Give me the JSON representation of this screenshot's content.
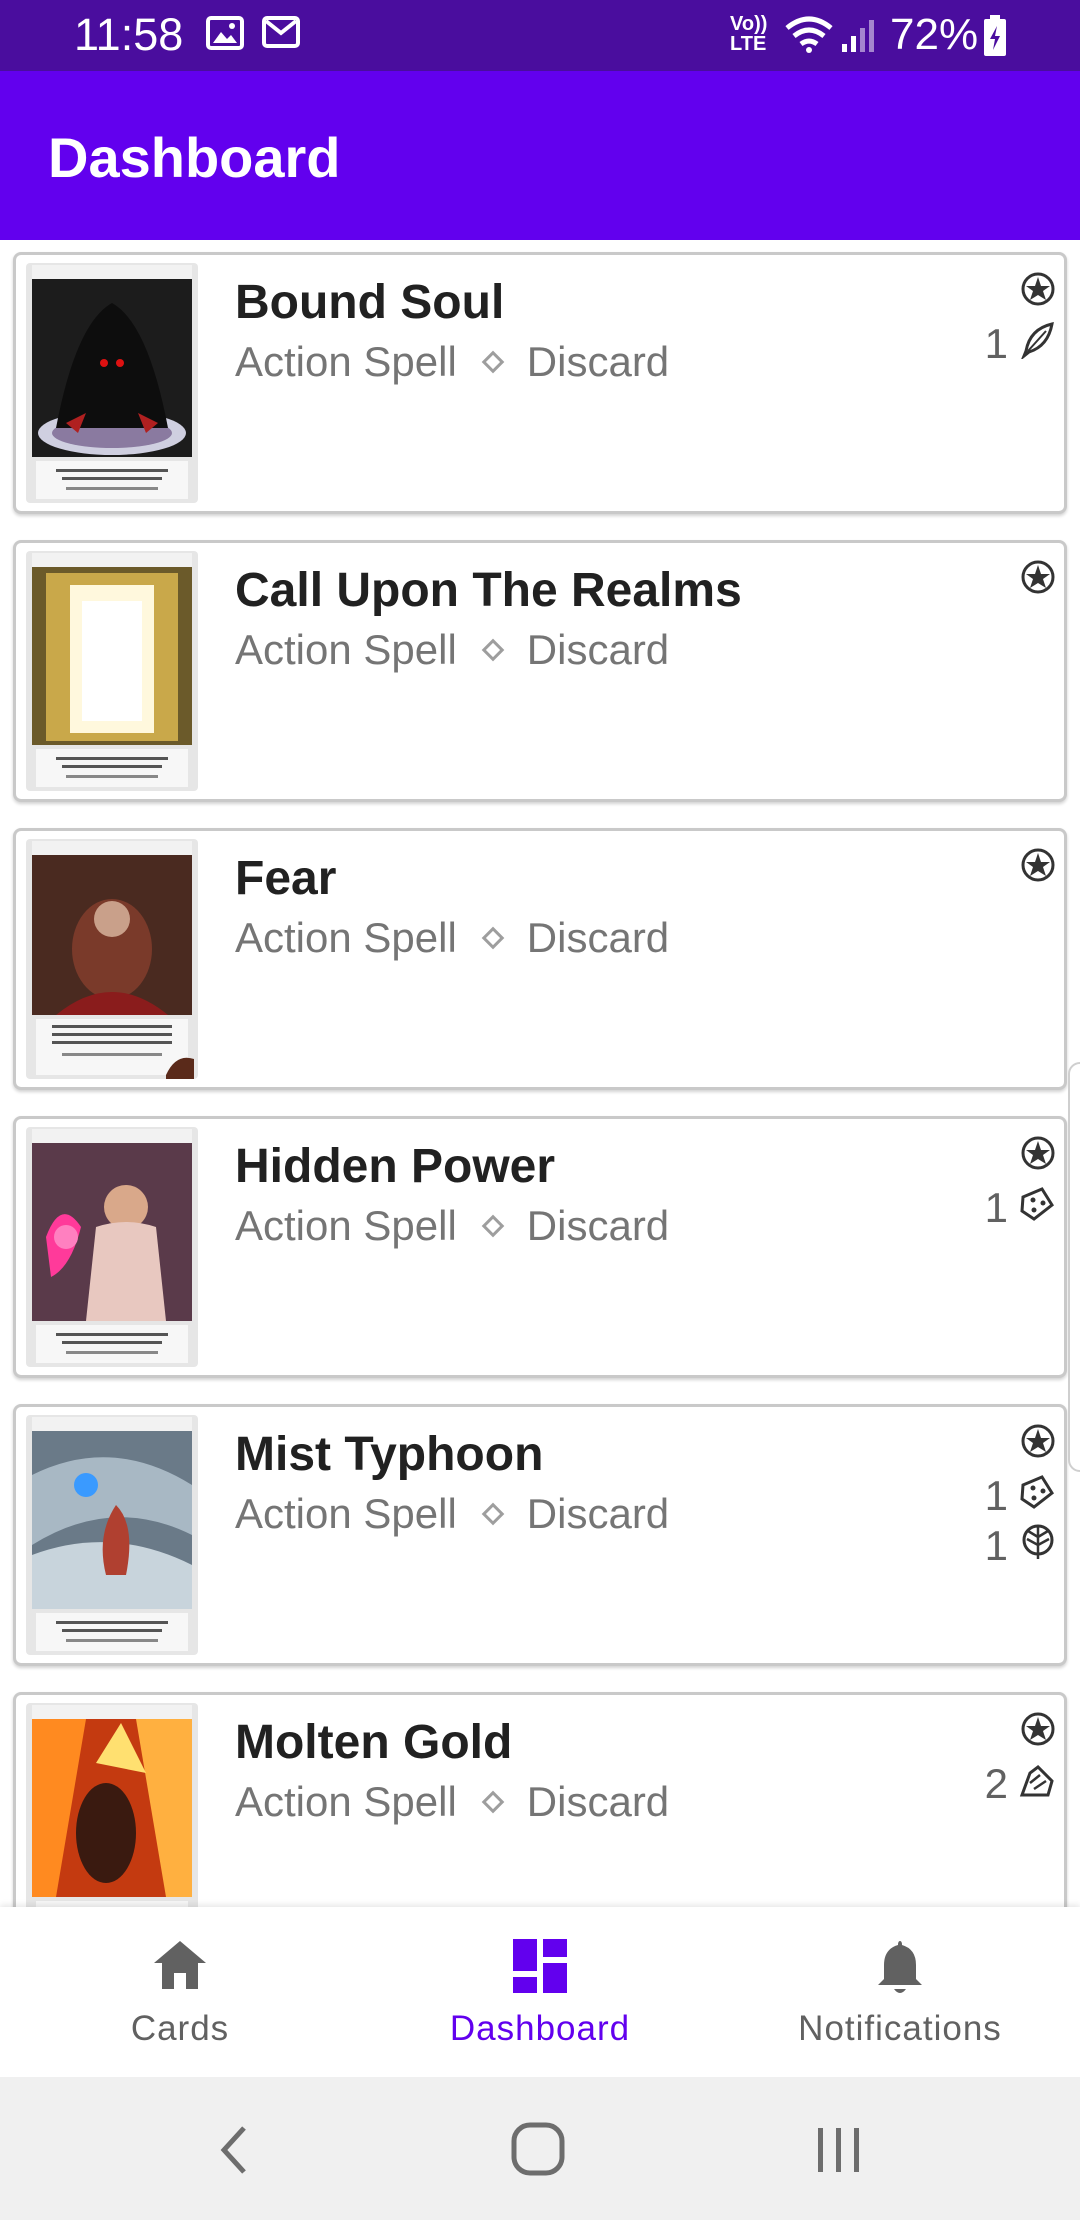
{
  "status_bar": {
    "time": "11:58",
    "battery": "72%",
    "icons": [
      "image-icon",
      "gmail-icon",
      "volte-icon",
      "wifi-icon",
      "signal-icon",
      "battery-icon"
    ],
    "volte_line1": "Vo))",
    "volte_line2": "LTE"
  },
  "app_bar": {
    "title": "Dashboard"
  },
  "cards": [
    {
      "name": "Bound Soul",
      "type": "Action Spell",
      "subtype": "Discard",
      "costs": [
        {
          "count": "",
          "icon": "basic-magic-icon"
        },
        {
          "count": "1",
          "icon": "charm-feather-icon"
        }
      ],
      "art": "dark"
    },
    {
      "name": "Call Upon The Realms",
      "type": "Action Spell",
      "subtype": "Discard",
      "costs": [
        {
          "count": "",
          "icon": "basic-magic-icon"
        }
      ],
      "art": "gold"
    },
    {
      "name": "Fear",
      "type": "Action Spell",
      "subtype": "Discard",
      "costs": [
        {
          "count": "",
          "icon": "basic-magic-icon"
        }
      ],
      "art": "brown"
    },
    {
      "name": "Hidden Power",
      "type": "Action Spell",
      "subtype": "Discard",
      "costs": [
        {
          "count": "",
          "icon": "basic-magic-icon"
        },
        {
          "count": "1",
          "icon": "class-die-icon"
        }
      ],
      "art": "pink"
    },
    {
      "name": "Mist Typhoon",
      "type": "Action Spell",
      "subtype": "Discard",
      "costs": [
        {
          "count": "",
          "icon": "basic-magic-icon"
        },
        {
          "count": "1",
          "icon": "class-die-icon"
        },
        {
          "count": "1",
          "icon": "natural-leaf-icon"
        }
      ],
      "art": "storm"
    },
    {
      "name": "Molten Gold",
      "type": "Action Spell",
      "subtype": "Discard",
      "costs": [
        {
          "count": "",
          "icon": "basic-magic-icon"
        },
        {
          "count": "2",
          "icon": "sympathy-icon"
        }
      ],
      "art": "fire"
    }
  ],
  "bottom_nav": {
    "items": [
      {
        "label": "Cards",
        "icon": "home-icon",
        "active": false
      },
      {
        "label": "Dashboard",
        "icon": "dashboard-icon",
        "active": true
      },
      {
        "label": "Notifications",
        "icon": "bell-icon",
        "active": false
      }
    ]
  },
  "system_nav": [
    "back-icon",
    "home-circle-icon",
    "recents-icon"
  ],
  "colors": {
    "status_bar": "#4a0d9e",
    "app_bar": "#6200ee",
    "accent": "#6200ee",
    "text_secondary": "#757575"
  }
}
